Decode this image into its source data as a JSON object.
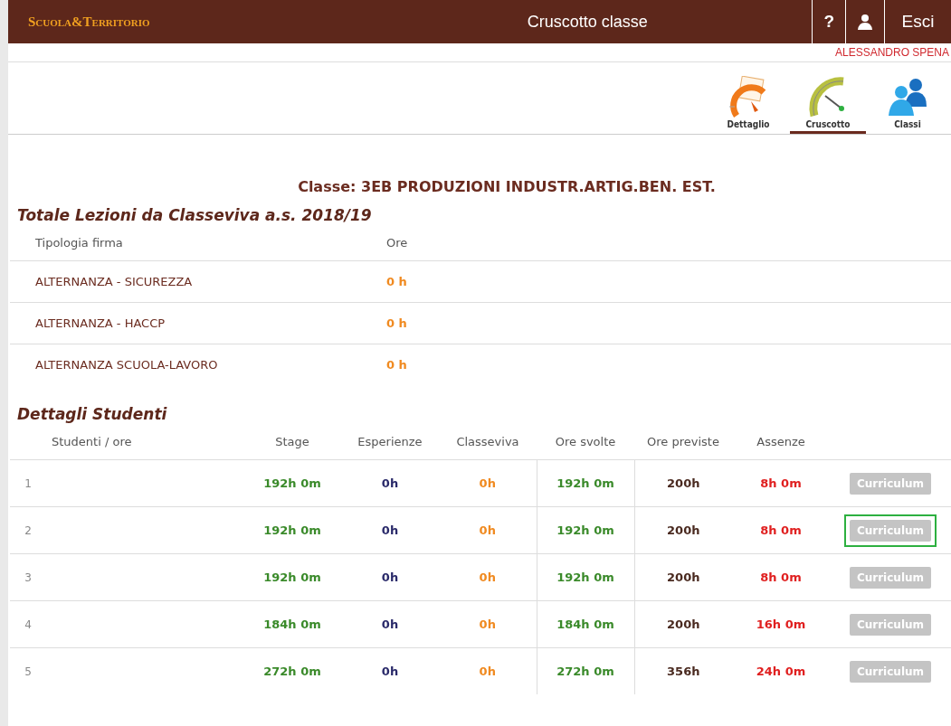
{
  "header": {
    "logo": "Scuola&Territorio",
    "title": "Cruscotto classe",
    "help": "?",
    "logout": "Esci"
  },
  "user": "ALESSANDRO SPENA",
  "nav": [
    {
      "kind": "detail",
      "label": "Dettaglio",
      "selected": false
    },
    {
      "kind": "dashboard",
      "label": "Cruscotto",
      "selected": true
    },
    {
      "kind": "classes",
      "label": "Classi",
      "selected": false
    }
  ],
  "class_title": "Classe: 3EB PRODUZIONI INDUSTR.ARTIG.BEN. EST.",
  "lessons": {
    "title": "Totale Lezioni da Classeviva a.s. 2018/19",
    "columns": [
      "Tipologia firma",
      "Ore"
    ],
    "rows": [
      {
        "type": "ALTERNANZA - SICUREZZA",
        "hours": "0 h"
      },
      {
        "type": "ALTERNANZA - HACCP",
        "hours": "0 h"
      },
      {
        "type": "ALTERNANZA SCUOLA-LAVORO",
        "hours": "0 h"
      }
    ]
  },
  "students": {
    "title": "Dettagli Studenti",
    "columns": [
      "Studenti / ore",
      "Stage",
      "Esperienze",
      "Classeviva",
      "Ore svolte",
      "Ore previste",
      "Assenze"
    ],
    "rows": [
      {
        "index": "1",
        "stage": "192h 0m",
        "esperienze": "0h",
        "classeviva": "0h",
        "ore_svolte": "192h 0m",
        "ore_previste": "200h",
        "assenze": "8h 0m",
        "button": "Curriculum",
        "selected": false
      },
      {
        "index": "2",
        "stage": "192h 0m",
        "esperienze": "0h",
        "classeviva": "0h",
        "ore_svolte": "192h 0m",
        "ore_previste": "200h",
        "assenze": "8h 0m",
        "button": "Curriculum",
        "selected": true
      },
      {
        "index": "3",
        "stage": "192h 0m",
        "esperienze": "0h",
        "classeviva": "0h",
        "ore_svolte": "192h 0m",
        "ore_previste": "200h",
        "assenze": "8h 0m",
        "button": "Curriculum",
        "selected": false
      },
      {
        "index": "4",
        "stage": "184h 0m",
        "esperienze": "0h",
        "classeviva": "0h",
        "ore_svolte": "184h 0m",
        "ore_previste": "200h",
        "assenze": "16h 0m",
        "button": "Curriculum",
        "selected": false
      },
      {
        "index": "5",
        "stage": "272h 0m",
        "esperienze": "0h",
        "classeviva": "0h",
        "ore_svolte": "272h 0m",
        "ore_previste": "356h",
        "assenze": "24h 0m",
        "button": "Curriculum",
        "selected": false
      }
    ]
  }
}
